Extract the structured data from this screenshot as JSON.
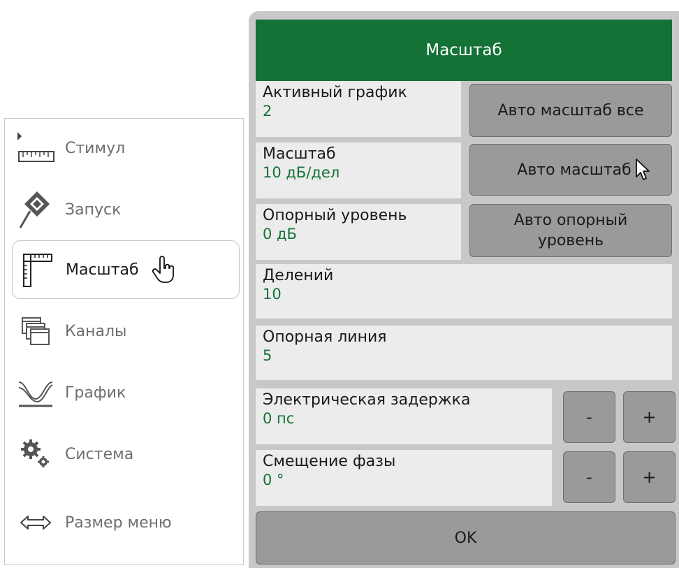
{
  "menu": {
    "items": [
      {
        "label": "Стимул",
        "icon": "ruler-stimulus-icon"
      },
      {
        "label": "Запуск",
        "icon": "trigger-diamond-icon"
      },
      {
        "label": "Масштаб",
        "icon": "scale-ruler-icon"
      },
      {
        "label": "Каналы",
        "icon": "channels-windows-icon"
      },
      {
        "label": "График",
        "icon": "trace-icon"
      },
      {
        "label": "Система",
        "icon": "gears-icon"
      },
      {
        "label": "Размер меню",
        "icon": "double-arrow-icon"
      }
    ],
    "active_index": 2
  },
  "dialog": {
    "title": "Масштаб",
    "active_trace": {
      "label": "Активный график",
      "value": "2"
    },
    "scale": {
      "label": "Масштаб",
      "value": "10 дБ/дел"
    },
    "ref_level": {
      "label": "Опорный уровень",
      "value": "0 дБ"
    },
    "divisions": {
      "label": "Делений",
      "value": "10"
    },
    "ref_position": {
      "label": "Опорная линия",
      "value": "5"
    },
    "electrical_delay": {
      "label": "Электрическая задержка",
      "value": "0 пс",
      "minus": "-",
      "plus": "+"
    },
    "phase_offset": {
      "label": "Смещение фазы",
      "value": "0 °",
      "minus": "-",
      "plus": "+"
    },
    "auto_scale_all": "Авто масштаб все",
    "auto_scale": "Авто масштаб",
    "auto_ref_level": "Авто опорный уровень",
    "ok": "OK"
  },
  "colors": {
    "accent": "#147237",
    "panel": "#c8c8c8",
    "field": "#ececec",
    "button": "#9a9a9a"
  }
}
